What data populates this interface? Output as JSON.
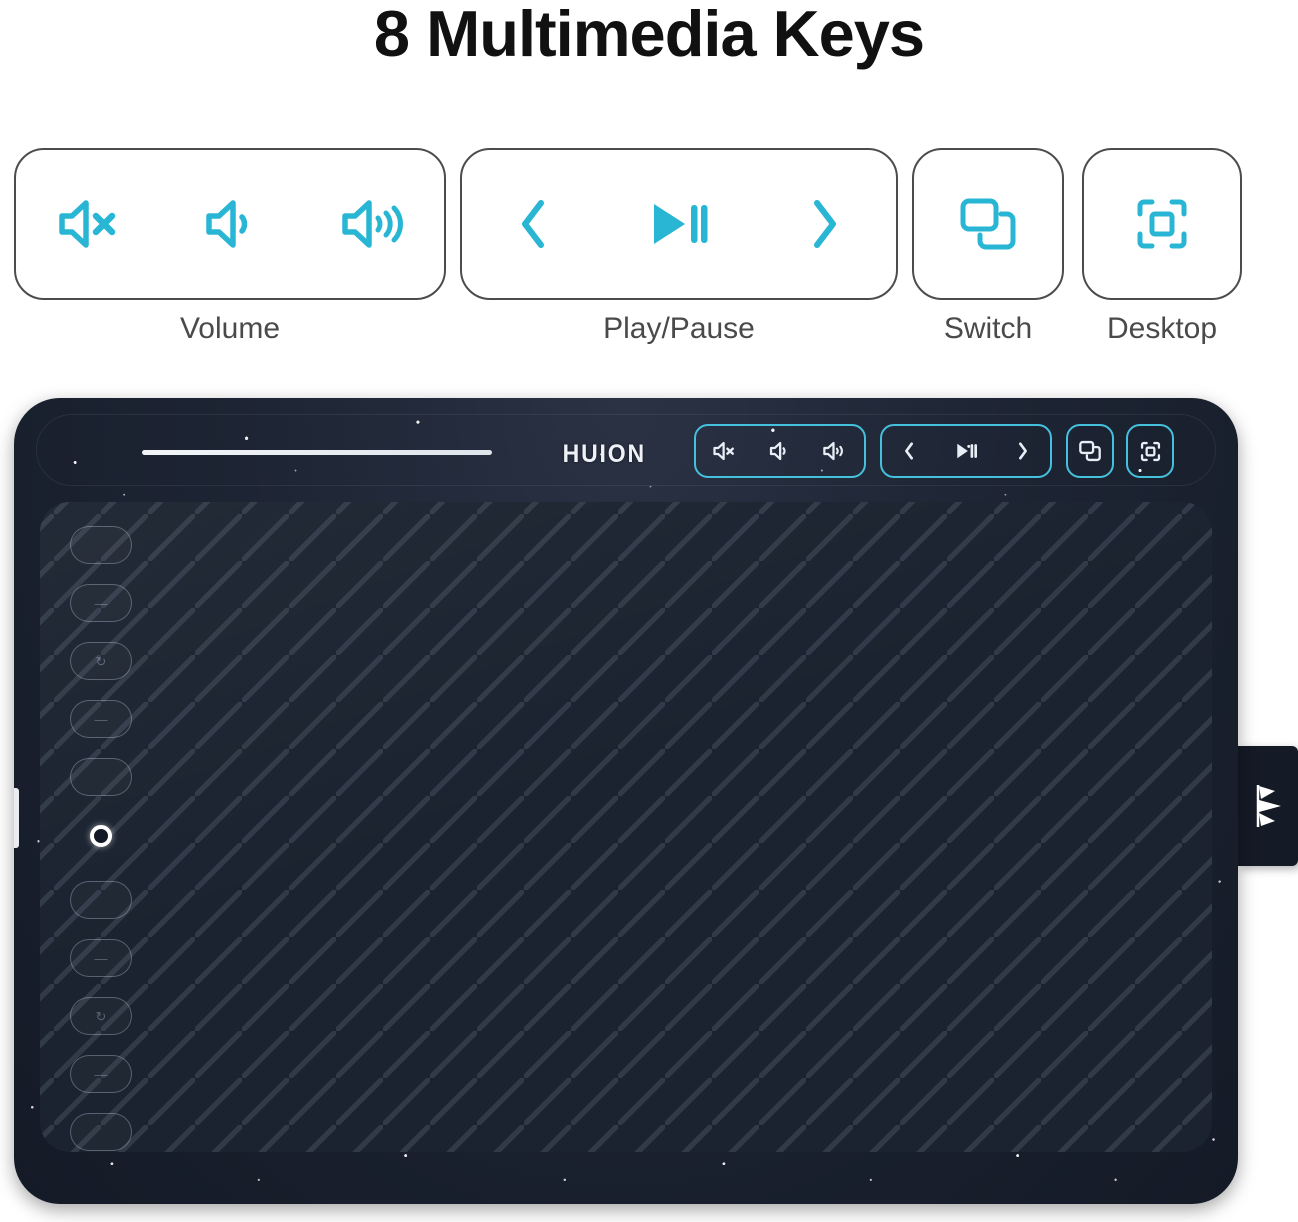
{
  "page": {
    "title": "8 Multimedia Keys",
    "background_color": "#ffffff"
  },
  "colors": {
    "accent_cyan": "#29b6d4",
    "tablet_accent_cyan": "#45c0dd",
    "card_border": "#4c4c4c",
    "caption_text": "#4a4a4a",
    "title_text": "#111111",
    "tablet_body": "#1d2433",
    "active_area": "#1b2330"
  },
  "callouts": [
    {
      "id": "volume",
      "caption": "Volume",
      "keys": [
        {
          "icon": "volume-mute-icon",
          "label": "Mute"
        },
        {
          "icon": "volume-down-icon",
          "label": "Volume Down"
        },
        {
          "icon": "volume-up-icon",
          "label": "Volume Up"
        }
      ]
    },
    {
      "id": "play",
      "caption": "Play/Pause",
      "keys": [
        {
          "icon": "previous-track-icon",
          "label": "Previous"
        },
        {
          "icon": "play-pause-icon",
          "label": "Play/Pause"
        },
        {
          "icon": "next-track-icon",
          "label": "Next"
        }
      ]
    },
    {
      "id": "switch",
      "caption": "Switch",
      "keys": [
        {
          "icon": "switch-window-icon",
          "label": "Switch"
        }
      ]
    },
    {
      "id": "desktop",
      "caption": "Desktop",
      "keys": [
        {
          "icon": "show-desktop-icon",
          "label": "Desktop"
        }
      ]
    }
  ],
  "tablet": {
    "brand": "HUION",
    "express_keys_count": 10,
    "express_key_glyphs": [
      "",
      "—",
      "↻",
      "—",
      "",
      "",
      "—",
      "↻",
      "—",
      ""
    ],
    "led_indicator": "power-led-ring",
    "key_groups": [
      {
        "id": "volume",
        "keys": [
          "volume-mute-icon",
          "volume-down-icon",
          "volume-up-icon"
        ]
      },
      {
        "id": "play",
        "keys": [
          "previous-track-icon",
          "play-pause-icon",
          "next-track-icon"
        ]
      },
      {
        "id": "switch",
        "keys": [
          "switch-window-icon"
        ]
      },
      {
        "id": "desktop",
        "keys": [
          "show-desktop-icon"
        ]
      }
    ]
  }
}
